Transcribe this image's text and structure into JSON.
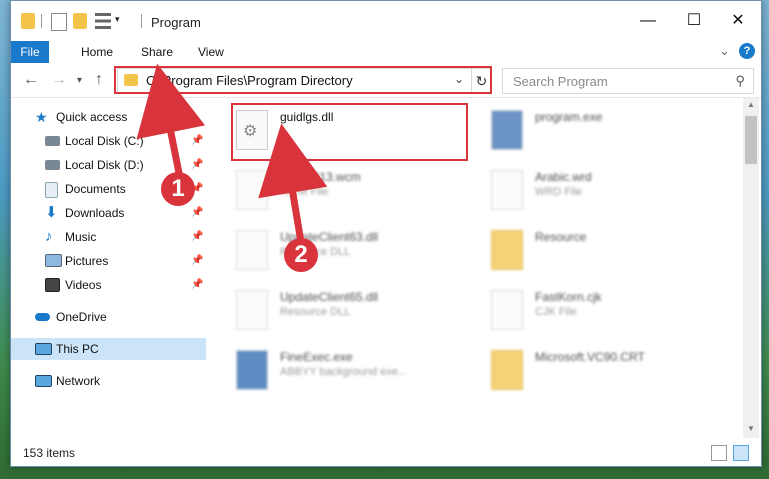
{
  "window": {
    "title": "Program"
  },
  "ribbon": {
    "file": "File",
    "home": "Home",
    "share": "Share",
    "view": "View"
  },
  "address": {
    "path": "C:\\Program Files\\Program Directory",
    "search_placeholder": "Search Program"
  },
  "sidebar": {
    "items": [
      {
        "label": "Quick access",
        "icon": "star-icon"
      },
      {
        "label": "Local Disk (C:)",
        "icon": "drive-icon",
        "pinned": true
      },
      {
        "label": "Local Disk (D:)",
        "icon": "drive-icon",
        "pinned": true
      },
      {
        "label": "Documents",
        "icon": "documents-icon",
        "pinned": true
      },
      {
        "label": "Downloads",
        "icon": "download-icon",
        "pinned": true
      },
      {
        "label": "Music",
        "icon": "music-icon",
        "pinned": true
      },
      {
        "label": "Pictures",
        "icon": "pictures-icon",
        "pinned": true
      },
      {
        "label": "Videos",
        "icon": "videos-icon",
        "pinned": true
      },
      {
        "label": "OneDrive",
        "icon": "cloud-icon"
      },
      {
        "label": "This PC",
        "icon": "computer-icon",
        "selected": true
      },
      {
        "label": "Network",
        "icon": "network-icon"
      }
    ]
  },
  "files": [
    {
      "name": "guidlgs.dll",
      "type": ""
    },
    {
      "name": "program.exe",
      "type": ""
    },
    {
      "name": "InfoWP13.wcm",
      "type": "WCM File"
    },
    {
      "name": "Arabic.wrd",
      "type": "WRD File"
    },
    {
      "name": "UpdateClient63.dll",
      "type": "Resource DLL"
    },
    {
      "name": "Resource",
      "type": ""
    },
    {
      "name": "UpdateClient65.dll",
      "type": "Resource DLL"
    },
    {
      "name": "FastKorn.cjk",
      "type": "CJK File"
    },
    {
      "name": "FineExec.exe",
      "type": "ABBYY background exe..."
    },
    {
      "name": "Microsoft.VC90.CRT",
      "type": ""
    }
  ],
  "status": {
    "count": "153 items"
  },
  "annotations": {
    "one": "1",
    "two": "2"
  },
  "colors": {
    "accent": "#1979ca",
    "highlight": "#d9343b",
    "selection": "#cce4f7"
  }
}
